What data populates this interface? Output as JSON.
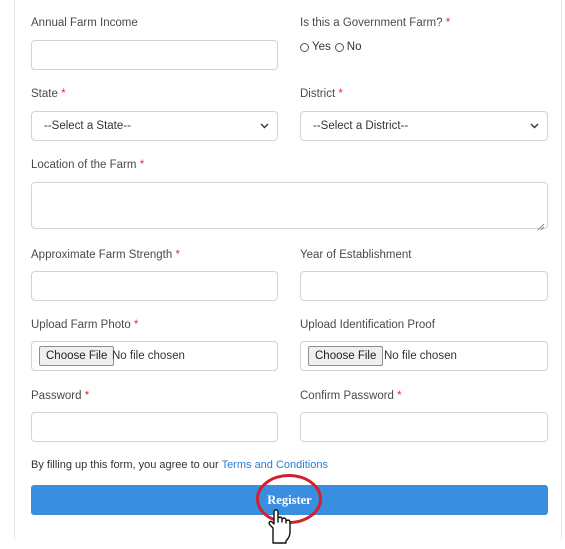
{
  "form": {
    "annual_income": {
      "label": "Annual Farm Income",
      "value": ""
    },
    "government": {
      "label": "Is this a Government Farm?",
      "required": "*",
      "options": [
        "Yes",
        "No"
      ]
    },
    "state": {
      "label": "State",
      "required": "*",
      "selected": "--Select a State--"
    },
    "district": {
      "label": "District",
      "required": "*",
      "selected": "--Select a District--"
    },
    "location": {
      "label": "Location of the Farm",
      "required": "*",
      "value": ""
    },
    "strength": {
      "label": "Approximate Farm Strength",
      "required": "*",
      "value": ""
    },
    "year": {
      "label": "Year of Establishment",
      "value": ""
    },
    "photo": {
      "label": "Upload Farm Photo",
      "required": "*",
      "button": "Choose File",
      "status": "No file chosen"
    },
    "id_proof": {
      "label": "Upload Identification Proof",
      "button": "Choose File",
      "status": "No file chosen"
    },
    "password": {
      "label": "Password",
      "required": "*",
      "value": ""
    },
    "confirm_password": {
      "label": "Confirm Password",
      "required": "*",
      "value": ""
    },
    "terms": {
      "prefix": "By filling up this form, you agree to our ",
      "link": "Terms and Conditions"
    },
    "register": {
      "label": "Register"
    }
  },
  "colors": {
    "required": "#e0322b",
    "link": "#2c7ad6",
    "primary_button": "#3a8ee0",
    "highlight_circle": "#d3202a"
  },
  "icons": [
    "chevron-down-icon",
    "resize-grip-icon",
    "hand-pointer-icon"
  ]
}
